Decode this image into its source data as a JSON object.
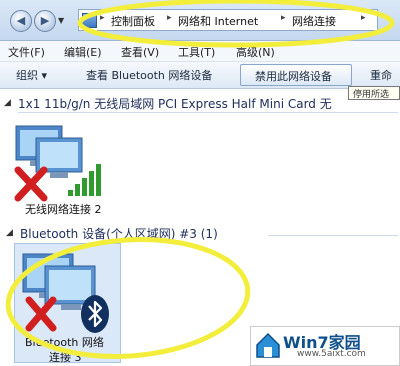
{
  "address_bar": {
    "crumbs": [
      "控制面板",
      "网络和 Internet",
      "网络连接"
    ]
  },
  "menu": [
    "文件(F)",
    "编辑(E)",
    "查看(V)",
    "工具(T)",
    "高级(N)"
  ],
  "toolbar": {
    "organize": "组织 ▾",
    "view_bluetooth": "查看 Bluetooth 网络设备",
    "disable": "禁用此网络设备",
    "rename": "重命",
    "tooltip": "停用所选"
  },
  "groups": [
    {
      "header": "1x1 11b/g/n 无线局域网 PCI Express Half Mini Card 无"
    },
    {
      "header": "Bluetooth 设备(个人区域网) #3 (1)"
    }
  ],
  "items": {
    "wireless_label": "无线网络连接 2",
    "bluetooth_label_line1": "Bluetooth 网络",
    "bluetooth_label_line2": "连接 3"
  },
  "watermark": {
    "title": "Win7家园",
    "url": "www.5aixt.com"
  },
  "colors": {
    "annotation": "#f3ee3c",
    "disabled_x": "#d11f1f",
    "signal": "#2f9b2f"
  }
}
